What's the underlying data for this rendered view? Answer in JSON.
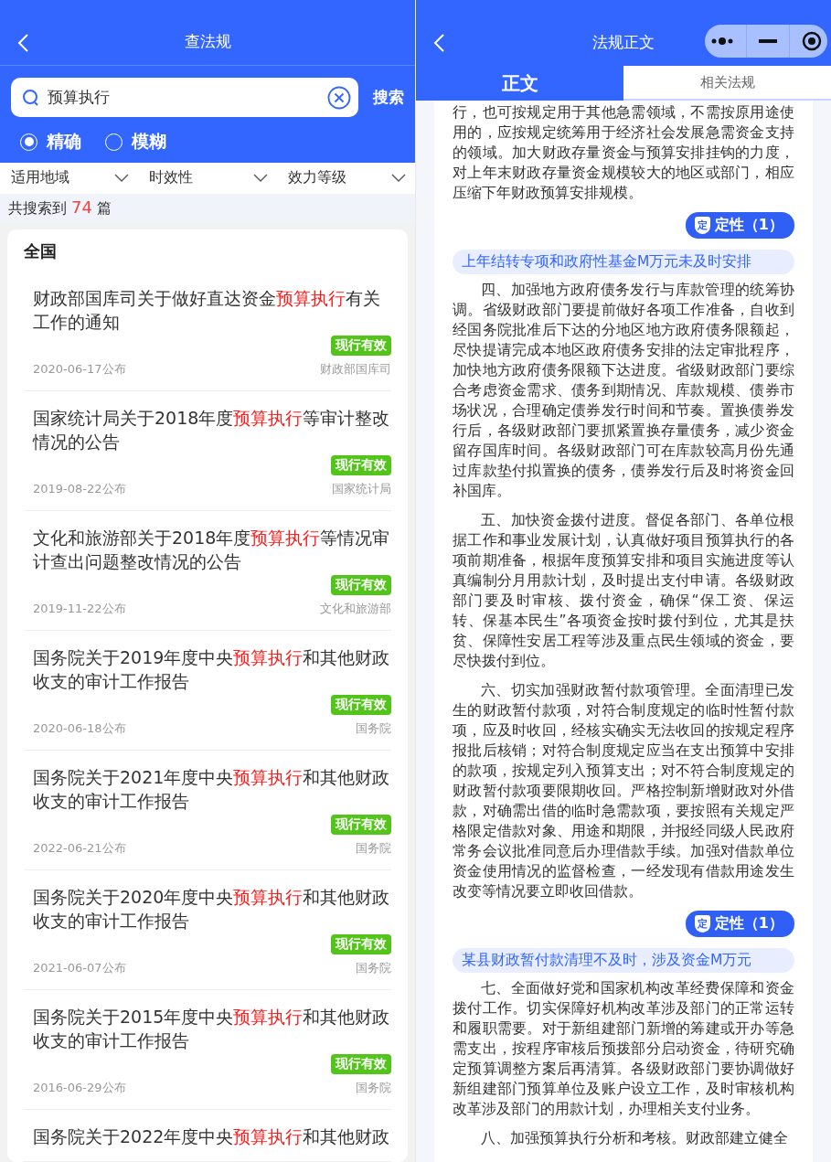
{
  "search_page": {
    "title": "查法规",
    "search": {
      "value": "预算执行",
      "button": "搜索"
    },
    "modes": [
      {
        "label": "精确",
        "selected": true
      },
      {
        "label": "模糊",
        "selected": false
      }
    ],
    "filters": [
      "适用地域",
      "时效性",
      "效力等级"
    ],
    "result_count": {
      "prefix": "共搜索到",
      "count": "74",
      "suffix": "篇"
    },
    "group": "全国",
    "results": [
      {
        "title": [
          {
            "text": "财政部国库司关于做好直达资金",
            "highlight": false
          },
          {
            "text": "预算执行",
            "highlight": true
          },
          {
            "text": "有关工作的通知",
            "highlight": false
          }
        ],
        "status": "现行有效",
        "date": "2020-06-17公布",
        "issuer": "财政部国库司"
      },
      {
        "title": [
          {
            "text": "国家统计局关于2018年度",
            "highlight": false
          },
          {
            "text": "预算执行",
            "highlight": true
          },
          {
            "text": "等审计整改情况的公告",
            "highlight": false
          }
        ],
        "status": "现行有效",
        "date": "2019-08-22公布",
        "issuer": "国家统计局"
      },
      {
        "title": [
          {
            "text": "文化和旅游部关于2018年度",
            "highlight": false
          },
          {
            "text": "预算执行",
            "highlight": true
          },
          {
            "text": "等情况审计查出问题整改情况的公告",
            "highlight": false
          }
        ],
        "status": "现行有效",
        "date": "2019-11-22公布",
        "issuer": "文化和旅游部"
      },
      {
        "title": [
          {
            "text": "国务院关于2019年度中央",
            "highlight": false
          },
          {
            "text": "预算执行",
            "highlight": true
          },
          {
            "text": "和其他财政收支的审计工作报告",
            "highlight": false
          }
        ],
        "status": "现行有效",
        "date": "2020-06-18公布",
        "issuer": "国务院"
      },
      {
        "title": [
          {
            "text": "国务院关于2021年度中央",
            "highlight": false
          },
          {
            "text": "预算执行",
            "highlight": true
          },
          {
            "text": "和其他财政收支的审计工作报告",
            "highlight": false
          }
        ],
        "status": "现行有效",
        "date": "2022-06-21公布",
        "issuer": "国务院"
      },
      {
        "title": [
          {
            "text": "国务院关于2020年度中央",
            "highlight": false
          },
          {
            "text": "预算执行",
            "highlight": true
          },
          {
            "text": "和其他财政收支的审计工作报告",
            "highlight": false
          }
        ],
        "status": "现行有效",
        "date": "2021-06-07公布",
        "issuer": "国务院"
      },
      {
        "title": [
          {
            "text": "国务院关于2015年度中央",
            "highlight": false
          },
          {
            "text": "预算执行",
            "highlight": true
          },
          {
            "text": "和其他财政收支的审计工作报告",
            "highlight": false
          }
        ],
        "status": "现行有效",
        "date": "2016-06-29公布",
        "issuer": "国务院"
      },
      {
        "title": [
          {
            "text": "国务院关于2022年度中央",
            "highlight": false
          },
          {
            "text": "预算执行",
            "highlight": true
          },
          {
            "text": "和其他财政",
            "highlight": false
          }
        ]
      }
    ]
  },
  "article_page": {
    "title": "法规正文",
    "tabs": [
      {
        "label": "正文",
        "selected": true
      },
      {
        "label": "相关法规",
        "selected": false
      }
    ],
    "blocks": [
      {
        "kind": "paragraph",
        "indent": false,
        "text": "行，也可按规定用于其他急需领域，不需按原用途使用的，应按规定统筹用于经济社会发展急需资金支持的领域。加大财政存量资金与预算安排挂钩的力度，对上年末财政存量资金规模较大的地区或部门，相应压缩下年财政预算安排规模。"
      },
      {
        "kind": "tag",
        "icon": "定",
        "text": "定性（1）"
      },
      {
        "kind": "issue",
        "text": "上年结转专项和政府性基金M万元未及时安排"
      },
      {
        "kind": "paragraph",
        "indent": true,
        "text": "四、加强地方政府债务发行与库款管理的统筹协调。省级财政部门要提前做好各项工作准备，自收到经国务院批准后下达的分地区地方政府债务限额起，尽快提请完成本地区政府债务安排的法定审批程序，加快地方政府债务限额下达进度。省级财政部门要综合考虑资金需求、债务到期情况、库款规模、债券市场状况，合理确定债券发行时间和节奏。置换债券发行后，各级财政部门要抓紧置换存量债务，减少资金留存国库时间。各级财政部门可在库款较高月份先通过库款垫付拟置换的债务，债券发行后及时将资金回补国库。"
      },
      {
        "kind": "paragraph",
        "indent": true,
        "text": "五、加快资金拨付进度。督促各部门、各单位根据工作和事业发展计划，认真做好项目预算执行的各项前期准备，根据年度预算安排和项目实施进度等认真编制分月用款计划，及时提出支付申请。各级财政部门要及时审核、拨付资金，确保“保工资、保运转、保基本民生”各项资金按时拨付到位，尤其是扶贫、保障性安居工程等涉及重点民生领域的资金，要尽快拨付到位。"
      },
      {
        "kind": "paragraph",
        "indent": true,
        "text": "六、切实加强财政暂付款项管理。全面清理已发生的财政暂付款项，对符合制度规定的临时性暂付款项，应及时收回，经核实确实无法收回的按规定程序报批后核销；对符合制度规定应当在支出预算中安排的款项，按规定列入预算支出；对不符合制度规定的财政暂付款项要限期收回。严格控制新增财政对外借款，对确需出借的临时急需款项，要按照有关规定严格限定借款对象、用途和期限，并报经同级人民政府常务会议批准同意后办理借款手续。加强对借款单位资金使用情况的监督检查，一经发现有借款用途发生改变等情况要立即收回借款。"
      },
      {
        "kind": "tag",
        "icon": "定",
        "text": "定性（1）"
      },
      {
        "kind": "issue",
        "text": "某县财政暂付款清理不及时，涉及资金M万元"
      },
      {
        "kind": "paragraph",
        "indent": true,
        "text": "七、全面做好党和国家机构改革经费保障和资金拨付工作。切实保障好机构改革涉及部门的正常运转和履职需要。对于新组建部门新增的筹建或开办等急需支出，按程序审核后预拨部分启动资金，待研究确定预算调整方案后再清算。各级财政部门要协调做好新组建部门预算单位及账户设立工作，及时审核机构改革涉及部门的用款计划，办理相关支付业务。"
      },
      {
        "kind": "paragraph",
        "indent": true,
        "text": "八、加强预算执行分析和考核。财政部建立健全"
      }
    ]
  }
}
